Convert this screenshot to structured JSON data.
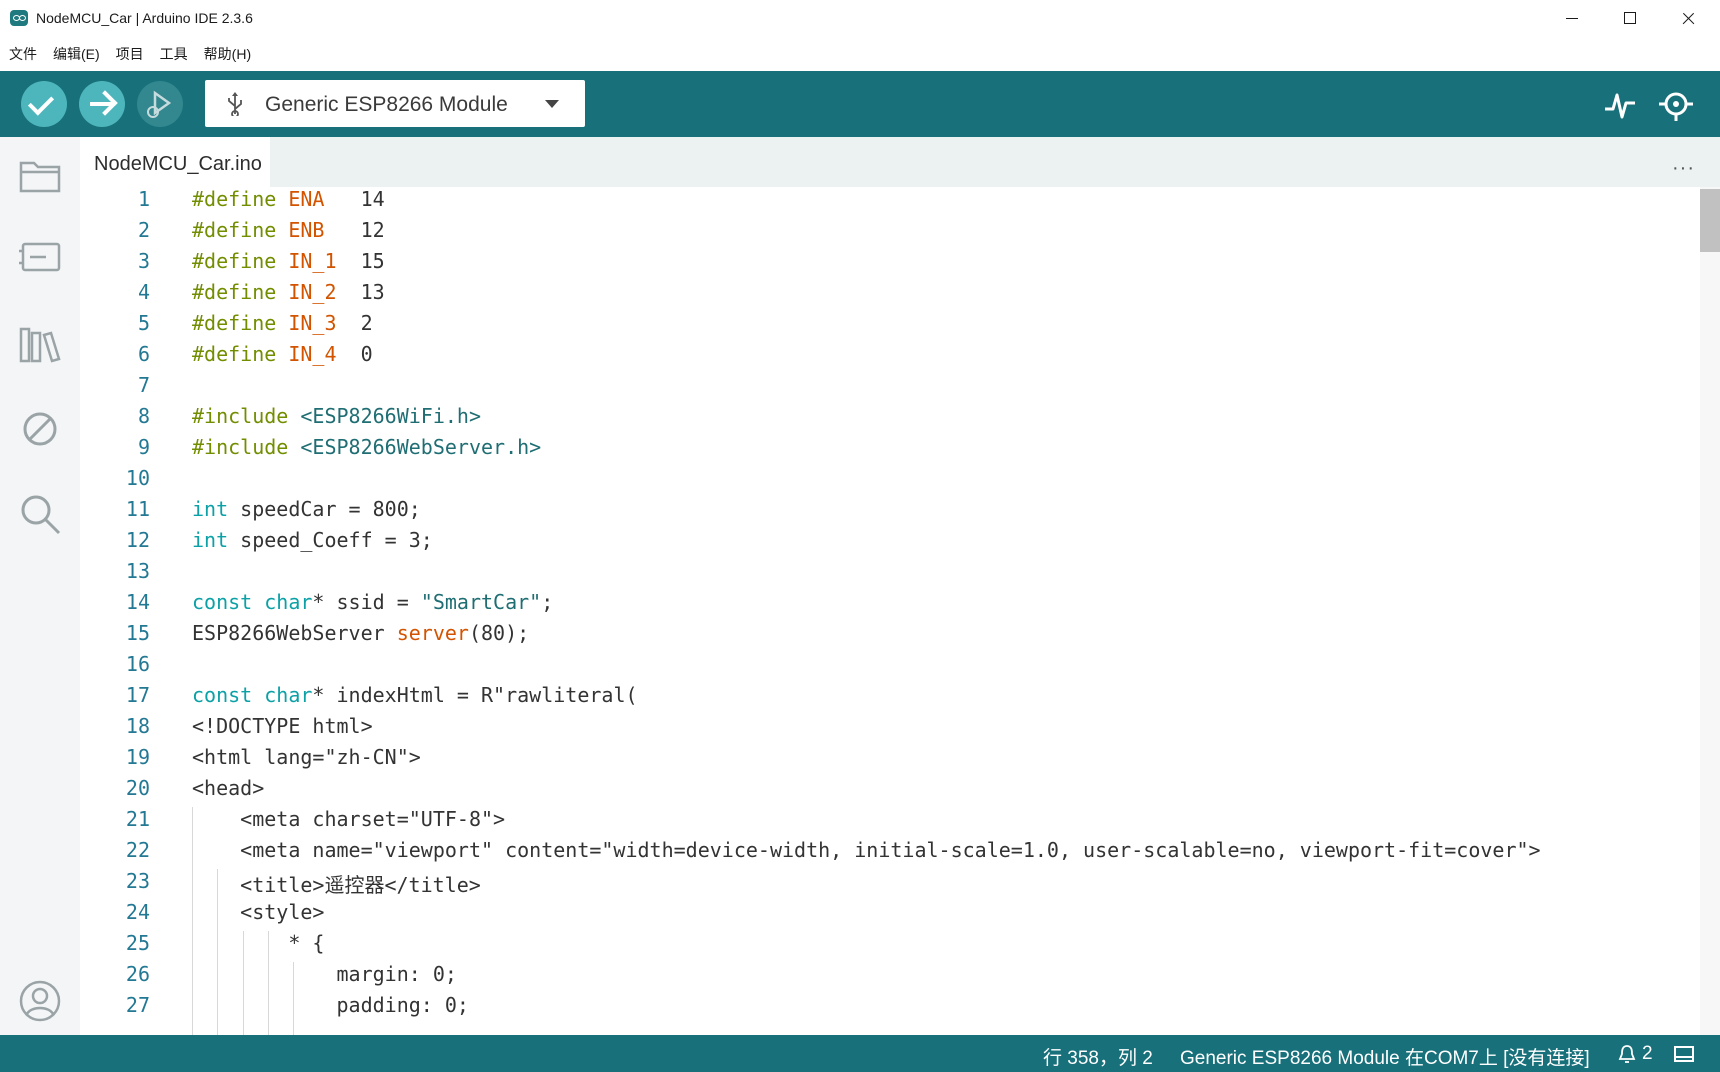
{
  "window": {
    "title": "NodeMCU_Car | Arduino IDE 2.3.6"
  },
  "menu": [
    "文件",
    "编辑(E)",
    "项目",
    "工具",
    "帮助(H)"
  ],
  "toolbar": {
    "board_name": "Generic ESP8266 Module"
  },
  "tab": {
    "filename": "NodeMCU_Car.ino",
    "more": "···"
  },
  "code_lines": [
    {
      "n": "1",
      "p": [
        "#define ",
        "ENA",
        "   14"
      ],
      "c": [
        "kw-pre",
        "kw-def",
        ""
      ]
    },
    {
      "n": "2",
      "p": [
        "#define ",
        "ENB",
        "   12"
      ],
      "c": [
        "kw-pre",
        "kw-def",
        ""
      ]
    },
    {
      "n": "3",
      "p": [
        "#define ",
        "IN_1",
        "  15"
      ],
      "c": [
        "kw-pre",
        "kw-def",
        ""
      ]
    },
    {
      "n": "4",
      "p": [
        "#define ",
        "IN_2",
        "  13"
      ],
      "c": [
        "kw-pre",
        "kw-def",
        ""
      ]
    },
    {
      "n": "5",
      "p": [
        "#define ",
        "IN_3",
        "  2"
      ],
      "c": [
        "kw-pre",
        "kw-def",
        ""
      ]
    },
    {
      "n": "6",
      "p": [
        "#define ",
        "IN_4",
        "  0"
      ],
      "c": [
        "kw-pre",
        "kw-def",
        ""
      ]
    },
    {
      "n": "7",
      "p": [
        ""
      ],
      "c": [
        ""
      ]
    },
    {
      "n": "8",
      "p": [
        "#include ",
        "<ESP8266WiFi.h>"
      ],
      "c": [
        "kw-pre",
        "str"
      ]
    },
    {
      "n": "9",
      "p": [
        "#include ",
        "<ESP8266WebServer.h>"
      ],
      "c": [
        "kw-pre",
        "str"
      ]
    },
    {
      "n": "10",
      "p": [
        ""
      ],
      "c": [
        ""
      ]
    },
    {
      "n": "11",
      "p": [
        "int",
        " speedCar = 800;"
      ],
      "c": [
        "kw-type",
        ""
      ]
    },
    {
      "n": "12",
      "p": [
        "int",
        " speed_Coeff = 3;"
      ],
      "c": [
        "kw-type",
        ""
      ]
    },
    {
      "n": "13",
      "p": [
        ""
      ],
      "c": [
        ""
      ]
    },
    {
      "n": "14",
      "p": [
        "const char",
        "* ssid = ",
        "\"SmartCar\"",
        ";"
      ],
      "c": [
        "kw-type",
        "",
        "str",
        ""
      ]
    },
    {
      "n": "15",
      "p": [
        "ESP8266WebServer ",
        "server",
        "(80);"
      ],
      "c": [
        "",
        "kw-fn",
        ""
      ]
    },
    {
      "n": "16",
      "p": [
        ""
      ],
      "c": [
        ""
      ]
    },
    {
      "n": "17",
      "p": [
        "const char",
        "* indexHtml = R\"rawliteral("
      ],
      "c": [
        "kw-type",
        ""
      ]
    },
    {
      "n": "18",
      "p": [
        "<!DOCTYPE html>"
      ],
      "c": [
        ""
      ]
    },
    {
      "n": "19",
      "p": [
        "<html lang=\"zh-CN\">"
      ],
      "c": [
        ""
      ]
    },
    {
      "n": "20",
      "p": [
        "<head>"
      ],
      "c": [
        ""
      ]
    },
    {
      "n": "21",
      "p": [
        "    <meta charset=\"UTF-8\">"
      ],
      "c": [
        ""
      ]
    },
    {
      "n": "22",
      "p": [
        "    <meta name=\"viewport\" content=\"width=device-width, initial-scale=1.0, user-scalable=no, viewport-fit=cover\">"
      ],
      "c": [
        ""
      ]
    },
    {
      "n": "23",
      "p": [
        "    <title>遥控器</title>"
      ],
      "c": [
        ""
      ]
    },
    {
      "n": "24",
      "p": [
        "    <style>"
      ],
      "c": [
        ""
      ]
    },
    {
      "n": "25",
      "p": [
        "        * {"
      ],
      "c": [
        ""
      ]
    },
    {
      "n": "26",
      "p": [
        "            margin: 0;"
      ],
      "c": [
        ""
      ]
    },
    {
      "n": "27",
      "p": [
        "            padding: 0;"
      ],
      "c": [
        ""
      ]
    }
  ],
  "status": {
    "position": "行 358，列 2",
    "board": "Generic ESP8266 Module 在COM7上 [没有连接]",
    "notifications": "2"
  },
  "colors": {
    "teal": "#17707a",
    "button": "#4db6bc"
  }
}
